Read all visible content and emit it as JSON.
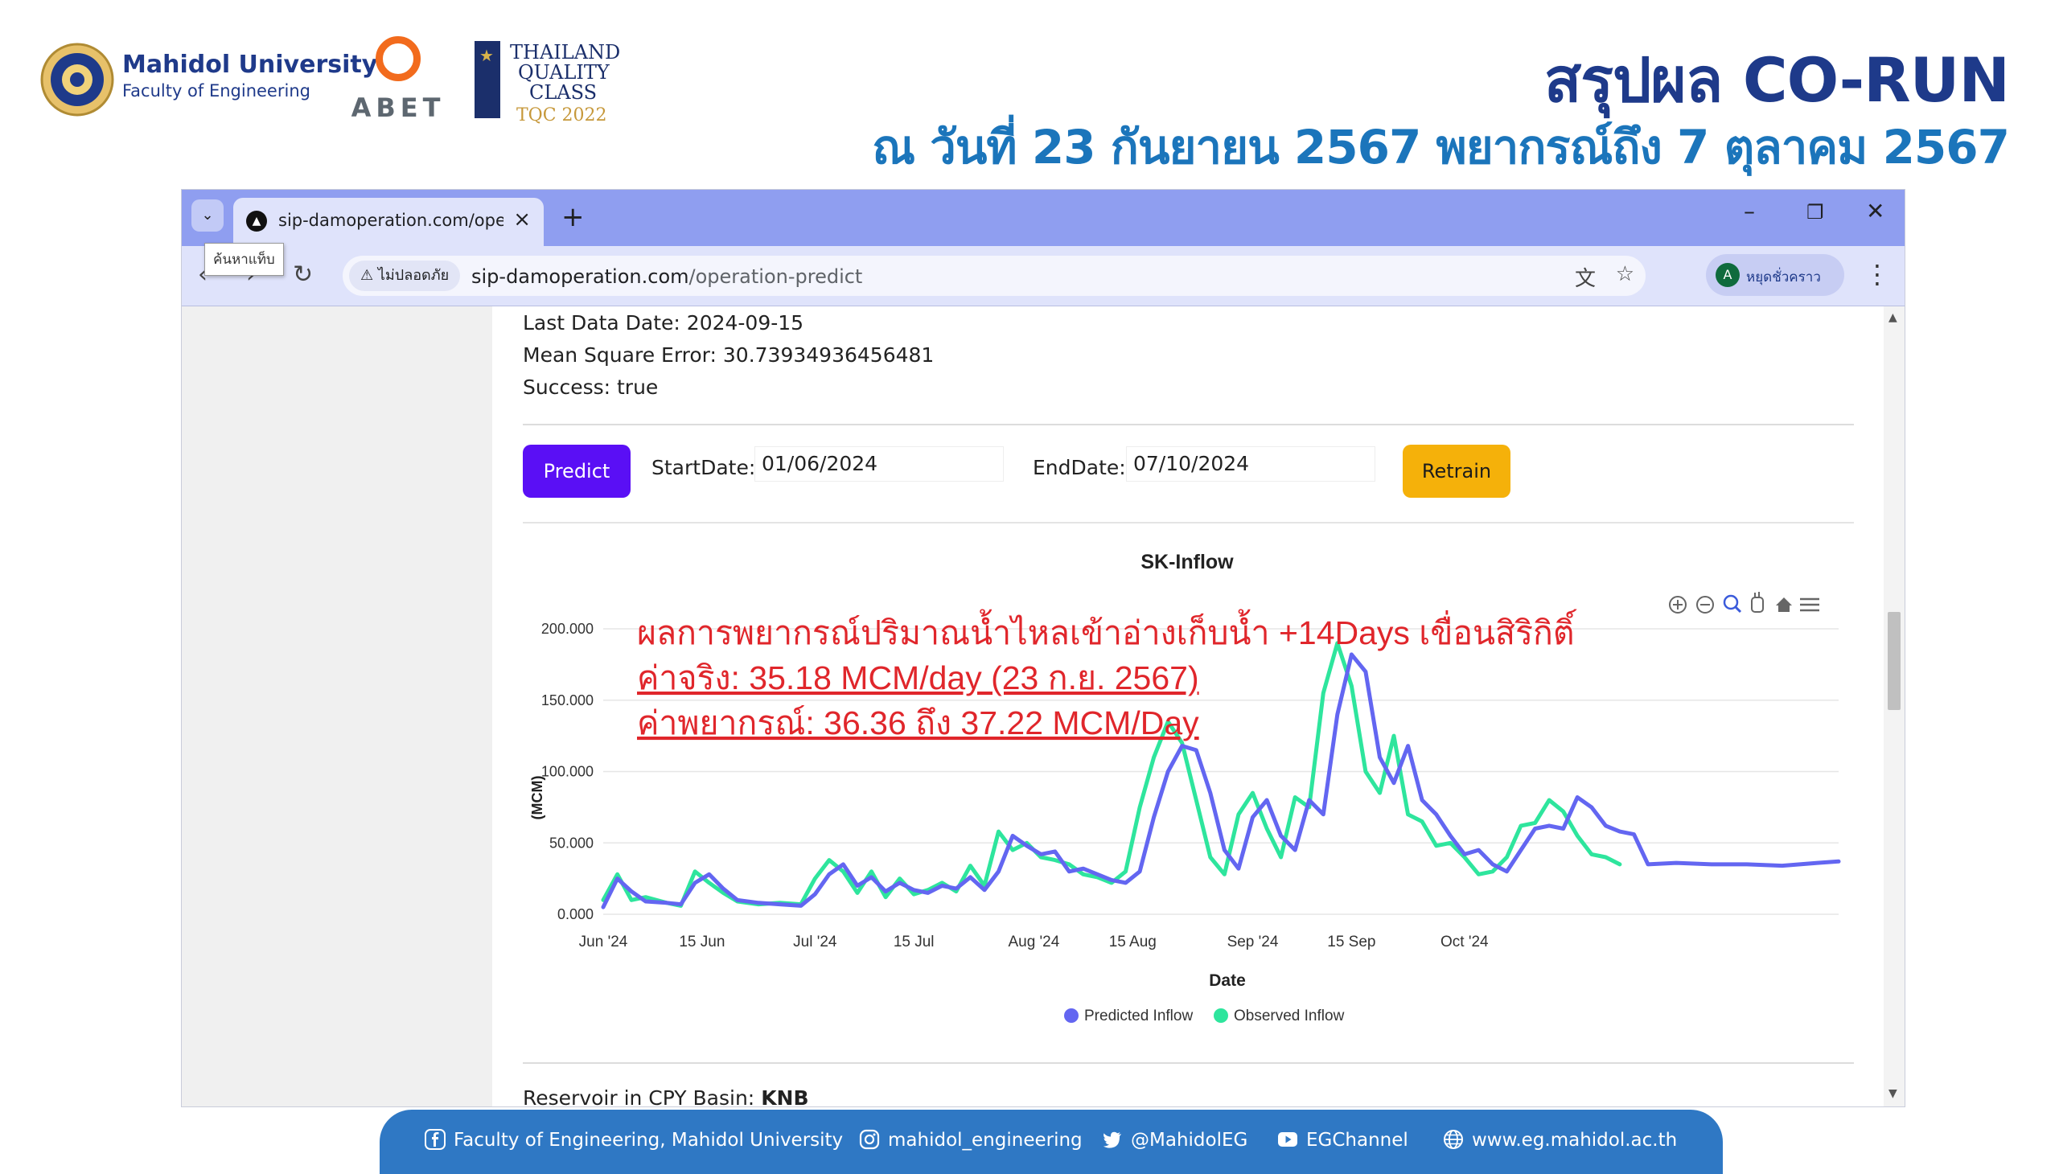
{
  "slide": {
    "logo_university": "Mahidol University",
    "logo_faculty": "Faculty of Engineering",
    "logo_abet": "ABET",
    "logo_tqc_line1": "THAILAND",
    "logo_tqc_line2": "QUALITY",
    "logo_tqc_line3": "CLASS",
    "logo_tqc_year": "TQC 2022",
    "title": "สรุปผล CO-RUN",
    "subtitle": "ณ วันที่ 23 กันยายน 2567 พยากรณ์ถึง 7 ตุลาคม 2567"
  },
  "browser": {
    "tab_title": "sip-damoperation.com/operation-predict",
    "tooltip": "ค้นหาแท็บ",
    "security_chip": "ไม่ปลอดภัย",
    "url_host": "sip-damoperation.com",
    "url_path": "/operation-predict",
    "profile_initial": "A",
    "profile_label": "หยุดชั่วคราว"
  },
  "page": {
    "last_data_date": "Last Data Date: 2024-09-15",
    "mse": "Mean Square Error: 30.73934936456481",
    "success": "Success: true",
    "predict_label": "Predict",
    "start_label": "StartDate:",
    "start_value": "01/06/2024",
    "end_label": "EndDate:",
    "end_value": "07/10/2024",
    "retrain_label": "Retrain",
    "next_section_label": "Reservoir in CPY Basin:",
    "next_section_value": "KNB"
  },
  "annotation": {
    "line1": "ผลการพยากรณ์ปริมาณน้ำไหลเข้าอ่างเก็บน้ำ +14Days เขื่อนสิริกิติ์",
    "line2": "ค่าจริง: 35.18 MCM/day (23 ก.ย. 2567)",
    "line3": "ค่าพยากรณ์: 36.36 ถึง 37.22 MCM/Day",
    "color": "#e0262b"
  },
  "chart_data": {
    "type": "line",
    "title": "SK-Inflow",
    "xlabel": "Date",
    "ylabel": "(MCM)",
    "ylim": [
      0,
      200
    ],
    "yticks": [
      "0.000",
      "50.000",
      "100.000",
      "150.000",
      "200.000"
    ],
    "xlim": [
      "2024-06-01",
      "2024-10-07"
    ],
    "xticks": [
      {
        "date": "2024-06-01",
        "label": "Jun '24"
      },
      {
        "date": "2024-06-15",
        "label": "15 Jun"
      },
      {
        "date": "2024-07-01",
        "label": "Jul '24"
      },
      {
        "date": "2024-07-15",
        "label": "15 Jul"
      },
      {
        "date": "2024-08-01",
        "label": "Aug '24"
      },
      {
        "date": "2024-08-15",
        "label": "15 Aug"
      },
      {
        "date": "2024-09-01",
        "label": "Sep '24"
      },
      {
        "date": "2024-09-15",
        "label": "15 Sep"
      },
      {
        "date": "2024-10-01",
        "label": "Oct '24"
      }
    ],
    "grid": true,
    "legend_position": "bottom",
    "series": [
      {
        "name": "Predicted Inflow",
        "color": "#6366f1",
        "points": [
          [
            "2024-06-01",
            5
          ],
          [
            "2024-06-03",
            25
          ],
          [
            "2024-06-05",
            16
          ],
          [
            "2024-06-07",
            9
          ],
          [
            "2024-06-10",
            8
          ],
          [
            "2024-06-12",
            7
          ],
          [
            "2024-06-14",
            22
          ],
          [
            "2024-06-16",
            28
          ],
          [
            "2024-06-18",
            18
          ],
          [
            "2024-06-20",
            10
          ],
          [
            "2024-06-23",
            8
          ],
          [
            "2024-06-26",
            7
          ],
          [
            "2024-06-29",
            6
          ],
          [
            "2024-07-01",
            14
          ],
          [
            "2024-07-03",
            28
          ],
          [
            "2024-07-05",
            35
          ],
          [
            "2024-07-07",
            20
          ],
          [
            "2024-07-09",
            26
          ],
          [
            "2024-07-11",
            16
          ],
          [
            "2024-07-13",
            22
          ],
          [
            "2024-07-15",
            17
          ],
          [
            "2024-07-17",
            15
          ],
          [
            "2024-07-19",
            20
          ],
          [
            "2024-07-21",
            18
          ],
          [
            "2024-07-23",
            26
          ],
          [
            "2024-07-25",
            17
          ],
          [
            "2024-07-27",
            30
          ],
          [
            "2024-07-29",
            55
          ],
          [
            "2024-07-31",
            48
          ],
          [
            "2024-08-02",
            42
          ],
          [
            "2024-08-04",
            44
          ],
          [
            "2024-08-06",
            30
          ],
          [
            "2024-08-08",
            32
          ],
          [
            "2024-08-10",
            28
          ],
          [
            "2024-08-12",
            24
          ],
          [
            "2024-08-14",
            22
          ],
          [
            "2024-08-16",
            30
          ],
          [
            "2024-08-18",
            68
          ],
          [
            "2024-08-20",
            100
          ],
          [
            "2024-08-22",
            118
          ],
          [
            "2024-08-24",
            115
          ],
          [
            "2024-08-26",
            85
          ],
          [
            "2024-08-28",
            45
          ],
          [
            "2024-08-30",
            32
          ],
          [
            "2024-09-01",
            68
          ],
          [
            "2024-09-03",
            80
          ],
          [
            "2024-09-05",
            55
          ],
          [
            "2024-09-07",
            45
          ],
          [
            "2024-09-09",
            80
          ],
          [
            "2024-09-11",
            70
          ],
          [
            "2024-09-13",
            140
          ],
          [
            "2024-09-15",
            182
          ],
          [
            "2024-09-17",
            170
          ],
          [
            "2024-09-19",
            110
          ],
          [
            "2024-09-21",
            92
          ],
          [
            "2024-09-23",
            118
          ],
          [
            "2024-09-25",
            80
          ],
          [
            "2024-09-27",
            70
          ],
          [
            "2024-09-29",
            55
          ],
          [
            "2024-10-01",
            42
          ],
          [
            "2024-10-03",
            45
          ],
          [
            "2024-10-05",
            35
          ],
          [
            "2024-10-07",
            30
          ],
          [
            "2024-10-09",
            45
          ],
          [
            "2024-10-11",
            60
          ],
          [
            "2024-10-13",
            62
          ],
          [
            "2024-10-15",
            60
          ],
          [
            "2024-10-17",
            82
          ],
          [
            "2024-10-19",
            75
          ],
          [
            "2024-10-21",
            62
          ],
          [
            "2024-10-23",
            58
          ],
          [
            "2024-10-25",
            56
          ],
          [
            "2024-10-27",
            35
          ],
          [
            "2024-10-31",
            36
          ],
          [
            "2024-11-05",
            35
          ],
          [
            "2024-11-10",
            35
          ],
          [
            "2024-11-15",
            34
          ],
          [
            "2024-11-20",
            36
          ],
          [
            "2024-11-23",
            37
          ]
        ]
      },
      {
        "name": "Observed Inflow",
        "color": "#2ee59d",
        "points": [
          [
            "2024-06-01",
            10
          ],
          [
            "2024-06-03",
            28
          ],
          [
            "2024-06-05",
            10
          ],
          [
            "2024-06-07",
            12
          ],
          [
            "2024-06-10",
            8
          ],
          [
            "2024-06-12",
            6
          ],
          [
            "2024-06-14",
            30
          ],
          [
            "2024-06-16",
            22
          ],
          [
            "2024-06-18",
            15
          ],
          [
            "2024-06-20",
            9
          ],
          [
            "2024-06-23",
            7
          ],
          [
            "2024-06-26",
            8
          ],
          [
            "2024-06-29",
            7
          ],
          [
            "2024-07-01",
            25
          ],
          [
            "2024-07-03",
            38
          ],
          [
            "2024-07-05",
            30
          ],
          [
            "2024-07-07",
            15
          ],
          [
            "2024-07-09",
            30
          ],
          [
            "2024-07-11",
            12
          ],
          [
            "2024-07-13",
            25
          ],
          [
            "2024-07-15",
            14
          ],
          [
            "2024-07-17",
            17
          ],
          [
            "2024-07-19",
            22
          ],
          [
            "2024-07-21",
            16
          ],
          [
            "2024-07-23",
            34
          ],
          [
            "2024-07-25",
            20
          ],
          [
            "2024-07-27",
            58
          ],
          [
            "2024-07-29",
            45
          ],
          [
            "2024-07-31",
            50
          ],
          [
            "2024-08-02",
            40
          ],
          [
            "2024-08-04",
            38
          ],
          [
            "2024-08-06",
            35
          ],
          [
            "2024-08-08",
            28
          ],
          [
            "2024-08-10",
            26
          ],
          [
            "2024-08-12",
            22
          ],
          [
            "2024-08-14",
            30
          ],
          [
            "2024-08-16",
            75
          ],
          [
            "2024-08-18",
            110
          ],
          [
            "2024-08-20",
            135
          ],
          [
            "2024-08-22",
            120
          ],
          [
            "2024-08-24",
            80
          ],
          [
            "2024-08-26",
            40
          ],
          [
            "2024-08-28",
            28
          ],
          [
            "2024-08-30",
            70
          ],
          [
            "2024-09-01",
            85
          ],
          [
            "2024-09-03",
            60
          ],
          [
            "2024-09-05",
            40
          ],
          [
            "2024-09-07",
            82
          ],
          [
            "2024-09-09",
            75
          ],
          [
            "2024-09-11",
            155
          ],
          [
            "2024-09-13",
            190
          ],
          [
            "2024-09-15",
            160
          ],
          [
            "2024-09-17",
            100
          ],
          [
            "2024-09-19",
            85
          ],
          [
            "2024-09-21",
            125
          ],
          [
            "2024-09-23",
            70
          ],
          [
            "2024-09-25",
            65
          ],
          [
            "2024-09-27",
            48
          ],
          [
            "2024-09-29",
            50
          ],
          [
            "2024-10-01",
            40
          ],
          [
            "2024-10-03",
            28
          ],
          [
            "2024-10-05",
            30
          ],
          [
            "2024-10-07",
            40
          ],
          [
            "2024-10-09",
            62
          ],
          [
            "2024-10-11",
            64
          ],
          [
            "2024-10-13",
            80
          ],
          [
            "2024-10-15",
            72
          ],
          [
            "2024-10-17",
            55
          ],
          [
            "2024-10-19",
            42
          ],
          [
            "2024-10-21",
            40
          ],
          [
            "2024-10-23",
            35
          ]
        ]
      }
    ]
  },
  "footer": {
    "facebook": "Faculty of Engineering, Mahidol University",
    "instagram": "mahidol_engineering",
    "twitter": "@MahidolEG",
    "youtube": "EGChannel",
    "web": "www.eg.mahidol.ac.th"
  }
}
